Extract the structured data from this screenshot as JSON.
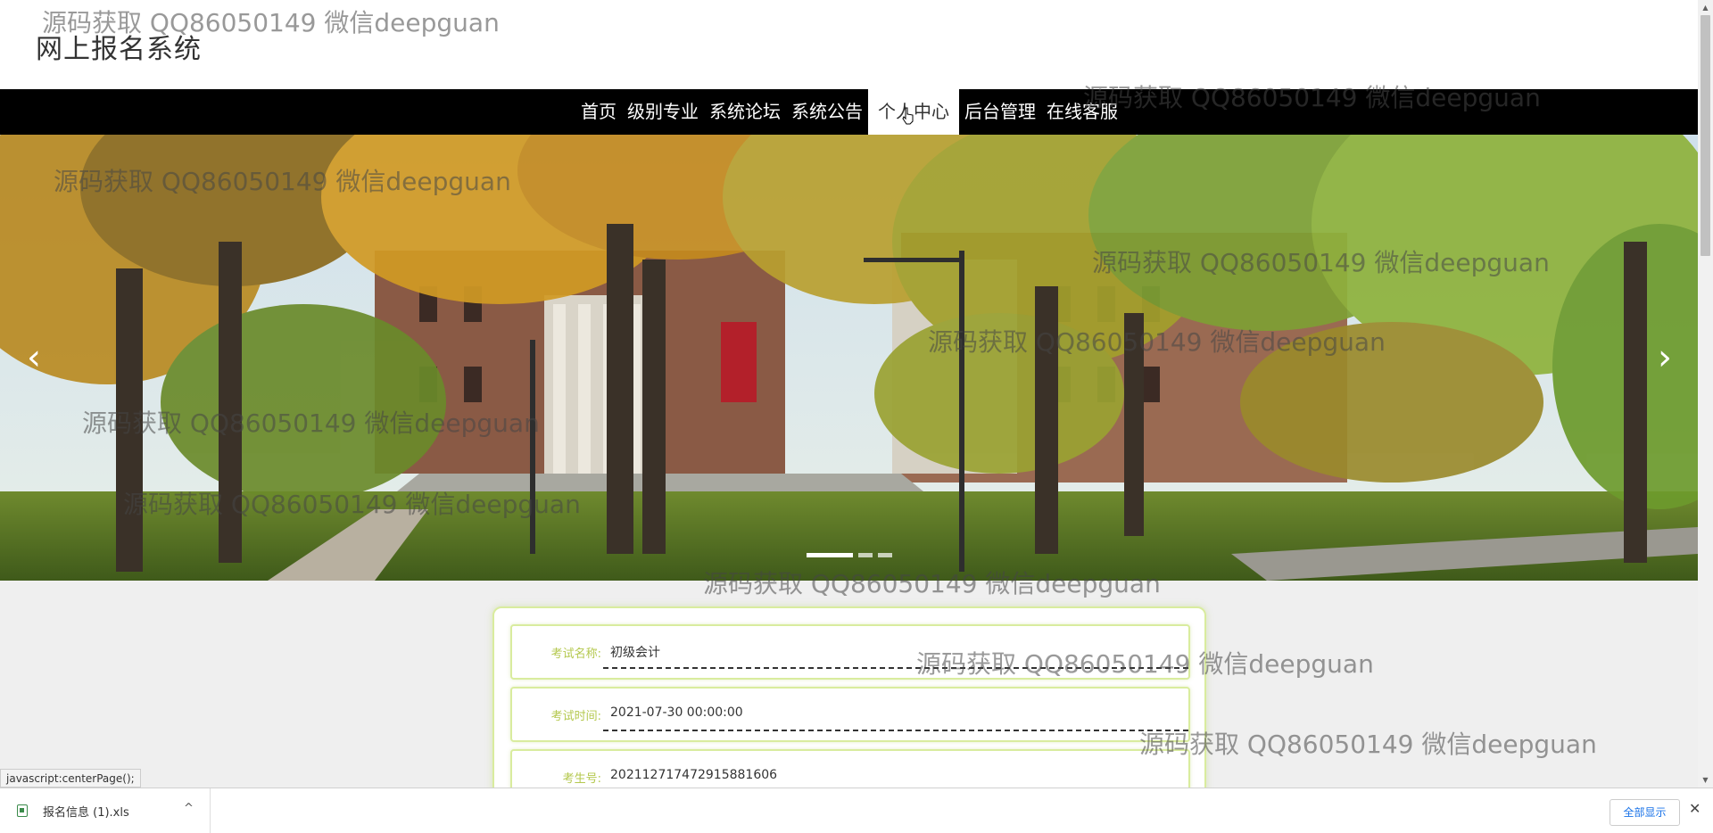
{
  "site": {
    "title": "网上报名系统"
  },
  "nav": {
    "items": [
      "首页",
      "级别专业",
      "系统论坛",
      "系统公告",
      "个人中心",
      "后台管理",
      "在线客服"
    ],
    "active_index": 4
  },
  "carousel": {
    "prev_icon": "chevron-left-icon",
    "next_icon": "chevron-right-icon",
    "prev_glyph": "‹",
    "next_glyph": "›",
    "slide_count": 3,
    "active_slide": 0
  },
  "profile": {
    "fields": [
      {
        "label": "考试名称:",
        "value": "初级会计"
      },
      {
        "label": "考试时间:",
        "value": "2021-07-30 00:00:00"
      },
      {
        "label": "考生号:",
        "value": "202112717472915881606"
      }
    ]
  },
  "status_bar": {
    "url": "javascript:centerPage();"
  },
  "download_bar": {
    "file_name": "报名信息 (1).xls",
    "chevron": "^",
    "show_all": "全部显示",
    "close": "✕"
  },
  "watermark": {
    "text": "源码获取 QQ86050149 微信deepguan"
  },
  "colors": {
    "nav_bg": "#000000",
    "field_border": "#d9ec9e",
    "field_label": "#b4c84e",
    "accent_link": "#1a73e8"
  }
}
